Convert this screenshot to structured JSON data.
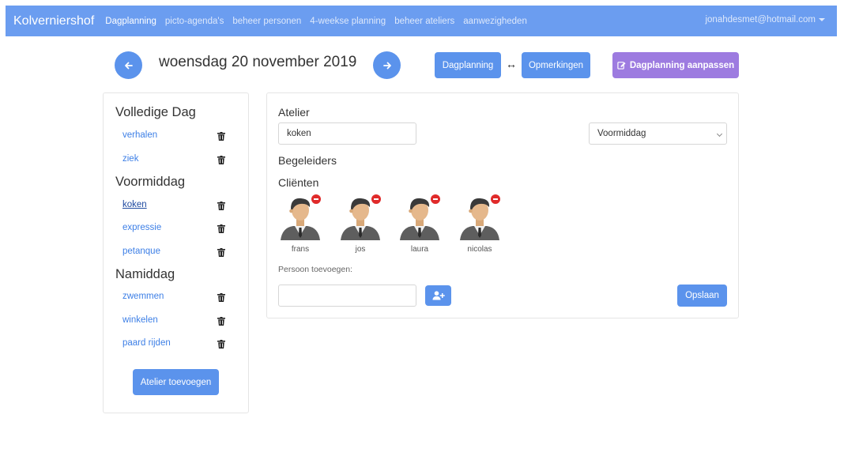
{
  "navbar": {
    "brand": "Kolverniershof",
    "items": [
      {
        "label": "Dagplanning"
      },
      {
        "label": "picto-agenda's"
      },
      {
        "label": "beheer personen"
      },
      {
        "label": "4-weekse planning"
      },
      {
        "label": "beheer ateliers"
      },
      {
        "label": "aanwezigheden"
      }
    ],
    "user": "jonahdesmet@hotmail.com"
  },
  "header": {
    "prev_icon": "arrow-left-icon",
    "next_icon": "arrow-right-icon",
    "date": "woensdag 20 november 2019",
    "btn_dagplanning": "Dagplanning",
    "swap_symbol": "↔",
    "btn_opmerkingen": "Opmerkingen",
    "btn_edit": "Dagplanning aanpassen"
  },
  "sidebar": {
    "sections": [
      {
        "title": "Volledige Dag",
        "items": [
          "verhalen",
          "ziek"
        ]
      },
      {
        "title": "Voormiddag",
        "items": [
          "koken",
          "expressie",
          "petanque"
        ]
      },
      {
        "title": "Namiddag",
        "items": [
          "zwemmen",
          "winkelen",
          "paard rijden"
        ]
      }
    ],
    "add_button": "Atelier toevoegen"
  },
  "detail": {
    "atelier_label": "Atelier",
    "atelier_value": "koken",
    "dayparts_selected": "Voormiddag",
    "begeleiders_label": "Begeleiders",
    "clienten_label": "Cliënten",
    "clients": [
      "frans",
      "jos",
      "laura",
      "nicolas"
    ],
    "add_person_label": "Persoon toevoegen:",
    "add_person_value": "",
    "save_button": "Opslaan"
  },
  "colors": {
    "nav": "#6b9df0",
    "primary": "#5b93ec",
    "purple": "#9d7be0",
    "remove": "#e02a2a"
  }
}
